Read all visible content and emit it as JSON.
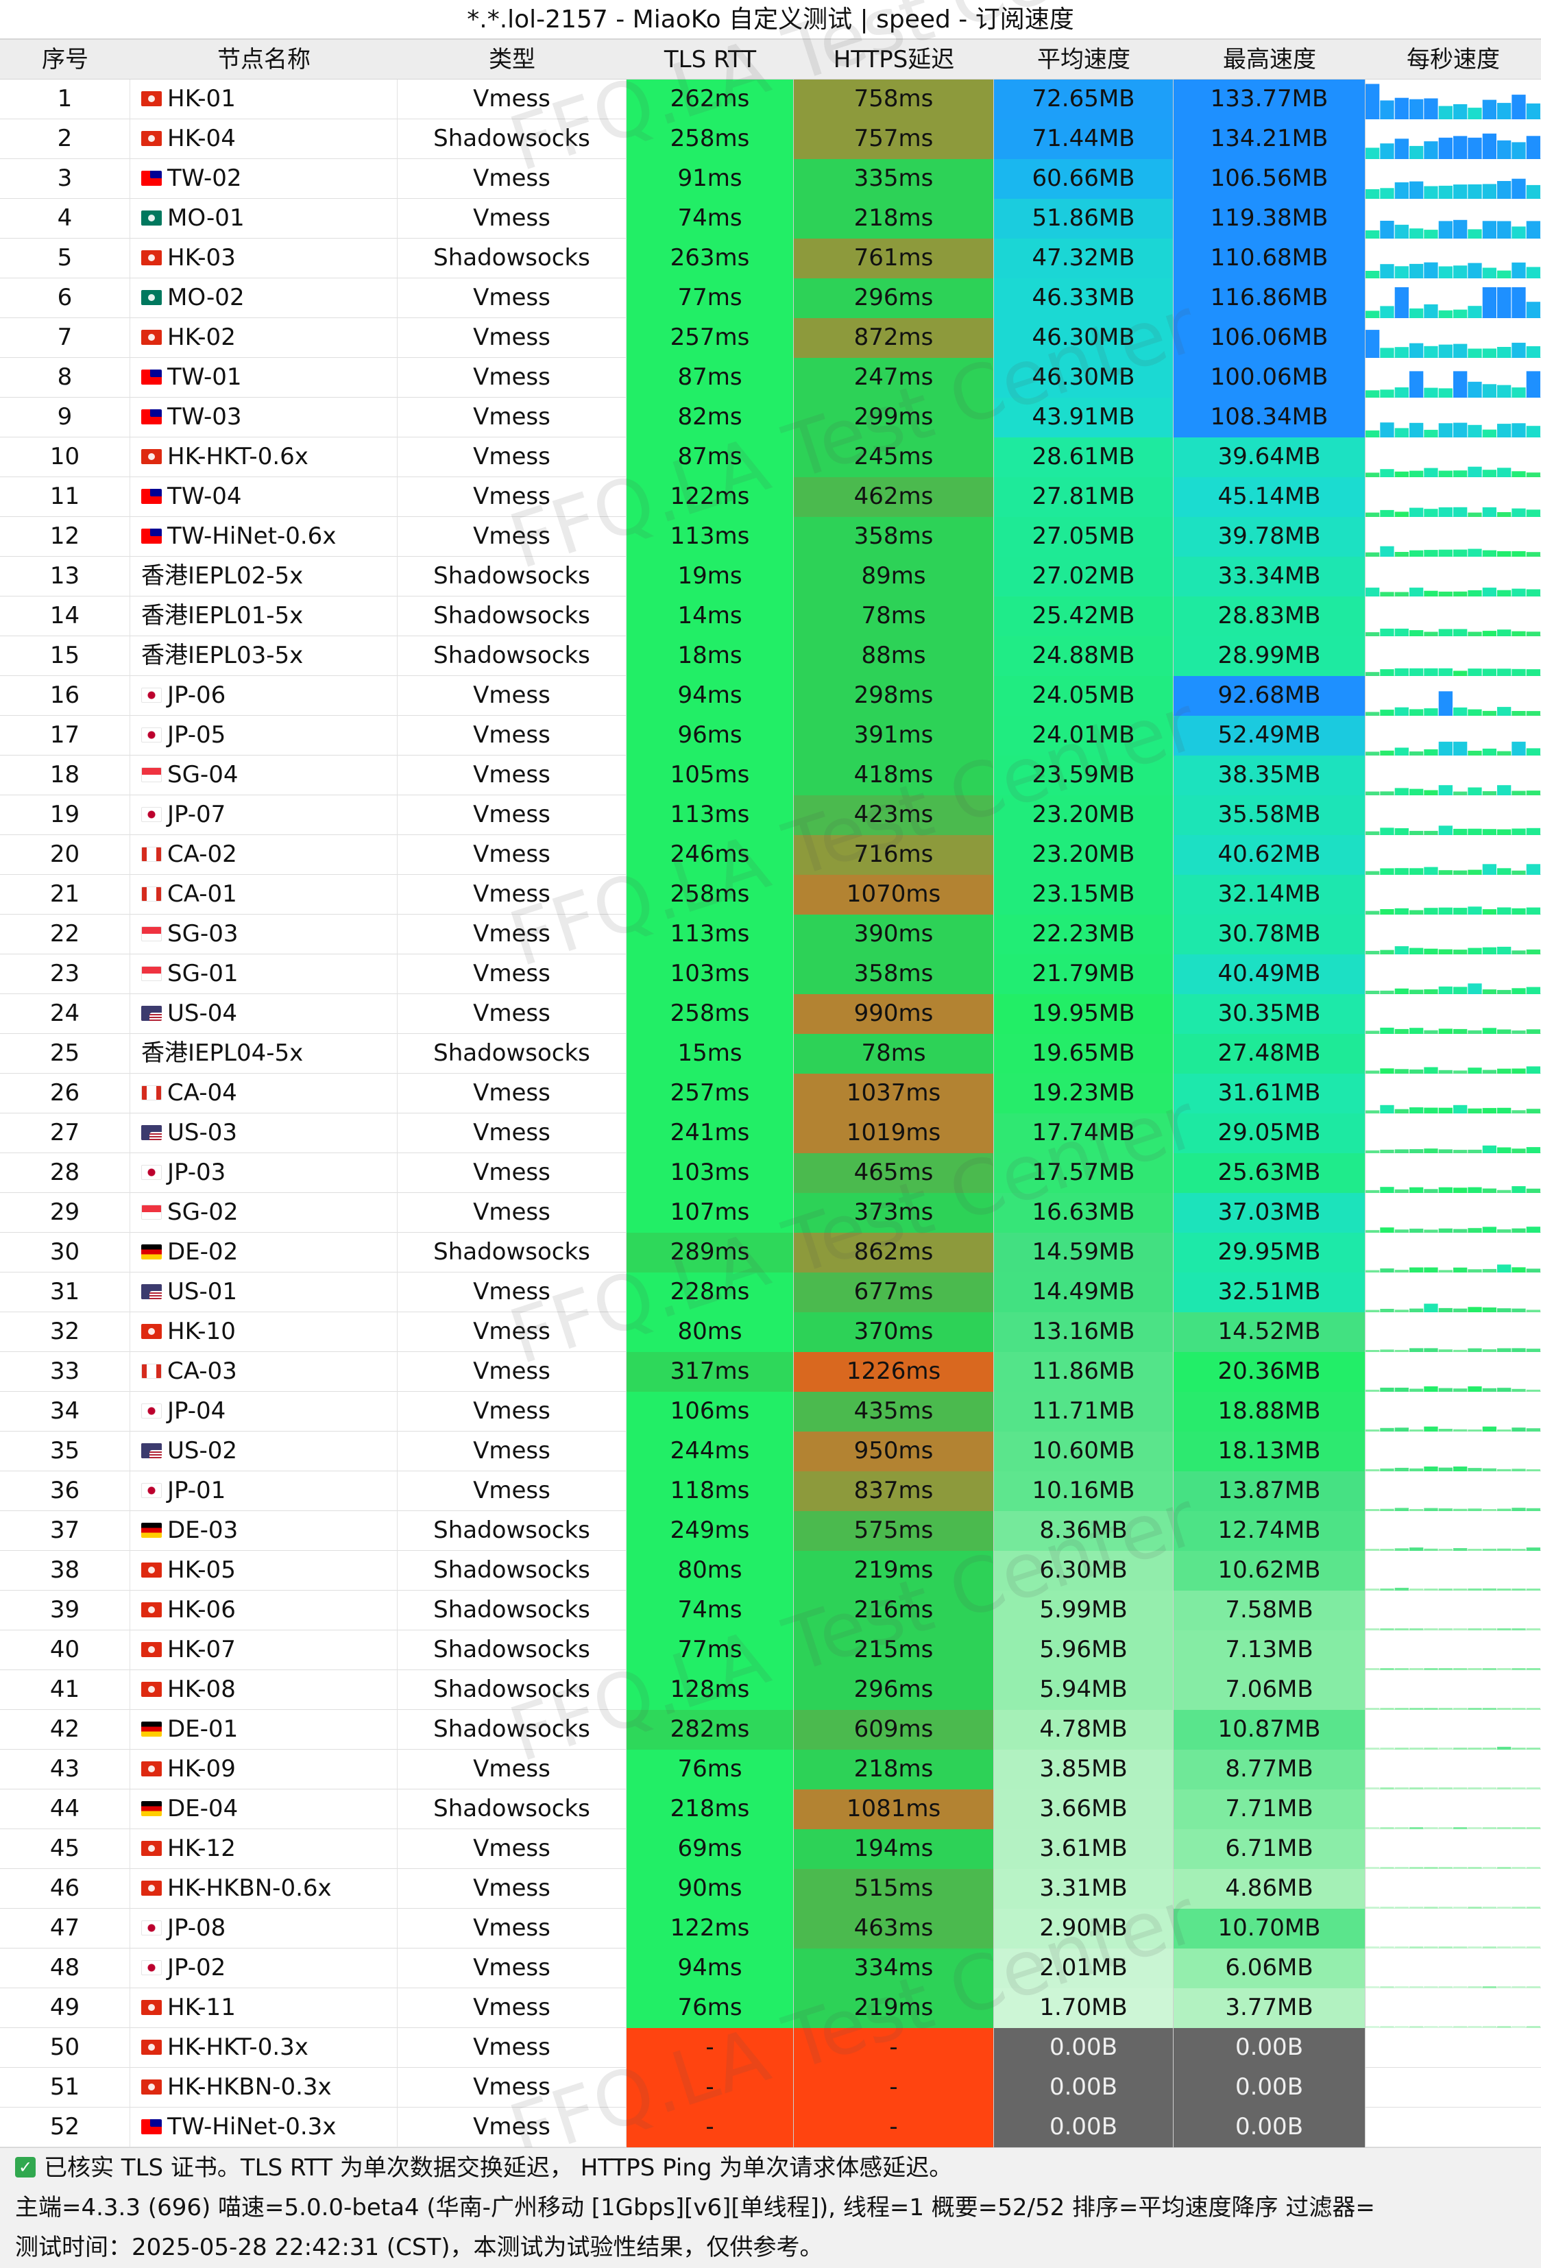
{
  "title": "*.*.lol-2157 - MiaoKo 自定义测试 | speed - 订阅速度",
  "header": {
    "idx": "序号",
    "name": "节点名称",
    "type": "类型",
    "tls": "TLS RTT",
    "https": "HTTPS延迟",
    "avg": "平均速度",
    "max": "最高速度",
    "spark": "每秒速度"
  },
  "watermark": "FFQ.LA Test Center",
  "colors": {
    "tls_normal": "#22ee66",
    "tls_slow": "#2ed85a",
    "tls_fail": "#ff4410",
    "https_fast": "#2dd257",
    "https_mid": "#4bba4e",
    "https_slow": "#8d9a3c",
    "https_very_slow": "#b38332",
    "https_worst": "#d9681f",
    "speed_fail": "#666666",
    "spark_blue": "#1e90ff"
  },
  "rows": [
    {
      "idx": "1",
      "flag": "HK",
      "name": "HK-01",
      "type": "Vmess",
      "tls": "262ms",
      "https": "758ms",
      "avg": "72.65MB",
      "max": "133.77MB",
      "avg_v": 72.65,
      "max_v": 133.77
    },
    {
      "idx": "2",
      "flag": "HK",
      "name": "HK-04",
      "type": "Shadowsocks",
      "tls": "258ms",
      "https": "757ms",
      "avg": "71.44MB",
      "max": "134.21MB",
      "avg_v": 71.44,
      "max_v": 134.21
    },
    {
      "idx": "3",
      "flag": "TW",
      "name": "TW-02",
      "type": "Vmess",
      "tls": "91ms",
      "https": "335ms",
      "avg": "60.66MB",
      "max": "106.56MB",
      "avg_v": 60.66,
      "max_v": 106.56
    },
    {
      "idx": "4",
      "flag": "MO",
      "name": "MO-01",
      "type": "Vmess",
      "tls": "74ms",
      "https": "218ms",
      "avg": "51.86MB",
      "max": "119.38MB",
      "avg_v": 51.86,
      "max_v": 119.38
    },
    {
      "idx": "5",
      "flag": "HK",
      "name": "HK-03",
      "type": "Shadowsocks",
      "tls": "263ms",
      "https": "761ms",
      "avg": "47.32MB",
      "max": "110.68MB",
      "avg_v": 47.32,
      "max_v": 110.68
    },
    {
      "idx": "6",
      "flag": "MO",
      "name": "MO-02",
      "type": "Vmess",
      "tls": "77ms",
      "https": "296ms",
      "avg": "46.33MB",
      "max": "116.86MB",
      "avg_v": 46.33,
      "max_v": 116.86
    },
    {
      "idx": "7",
      "flag": "HK",
      "name": "HK-02",
      "type": "Vmess",
      "tls": "257ms",
      "https": "872ms",
      "avg": "46.30MB",
      "max": "106.06MB",
      "avg_v": 46.3,
      "max_v": 106.06
    },
    {
      "idx": "8",
      "flag": "TW",
      "name": "TW-01",
      "type": "Vmess",
      "tls": "87ms",
      "https": "247ms",
      "avg": "46.30MB",
      "max": "100.06MB",
      "avg_v": 46.3,
      "max_v": 100.06
    },
    {
      "idx": "9",
      "flag": "TW",
      "name": "TW-03",
      "type": "Vmess",
      "tls": "82ms",
      "https": "299ms",
      "avg": "43.91MB",
      "max": "108.34MB",
      "avg_v": 43.91,
      "max_v": 108.34
    },
    {
      "idx": "10",
      "flag": "HK",
      "name": "HK-HKT-0.6x",
      "type": "Vmess",
      "tls": "87ms",
      "https": "245ms",
      "avg": "28.61MB",
      "max": "39.64MB",
      "avg_v": 28.61,
      "max_v": 39.64
    },
    {
      "idx": "11",
      "flag": "TW",
      "name": "TW-04",
      "type": "Vmess",
      "tls": "122ms",
      "https": "462ms",
      "avg": "27.81MB",
      "max": "45.14MB",
      "avg_v": 27.81,
      "max_v": 45.14
    },
    {
      "idx": "12",
      "flag": "TW",
      "name": "TW-HiNet-0.6x",
      "type": "Vmess",
      "tls": "113ms",
      "https": "358ms",
      "avg": "27.05MB",
      "max": "39.78MB",
      "avg_v": 27.05,
      "max_v": 39.78
    },
    {
      "idx": "13",
      "flag": "",
      "name": "香港IEPL02-5x",
      "type": "Shadowsocks",
      "tls": "19ms",
      "https": "89ms",
      "avg": "27.02MB",
      "max": "33.34MB",
      "avg_v": 27.02,
      "max_v": 33.34
    },
    {
      "idx": "14",
      "flag": "",
      "name": "香港IEPL01-5x",
      "type": "Shadowsocks",
      "tls": "14ms",
      "https": "78ms",
      "avg": "25.42MB",
      "max": "28.83MB",
      "avg_v": 25.42,
      "max_v": 28.83
    },
    {
      "idx": "15",
      "flag": "",
      "name": "香港IEPL03-5x",
      "type": "Shadowsocks",
      "tls": "18ms",
      "https": "88ms",
      "avg": "24.88MB",
      "max": "28.99MB",
      "avg_v": 24.88,
      "max_v": 28.99
    },
    {
      "idx": "16",
      "flag": "JP",
      "name": "JP-06",
      "type": "Vmess",
      "tls": "94ms",
      "https": "298ms",
      "avg": "24.05MB",
      "max": "92.68MB",
      "avg_v": 24.05,
      "max_v": 92.68
    },
    {
      "idx": "17",
      "flag": "JP",
      "name": "JP-05",
      "type": "Vmess",
      "tls": "96ms",
      "https": "391ms",
      "avg": "24.01MB",
      "max": "52.49MB",
      "avg_v": 24.01,
      "max_v": 52.49
    },
    {
      "idx": "18",
      "flag": "SG",
      "name": "SG-04",
      "type": "Vmess",
      "tls": "105ms",
      "https": "418ms",
      "avg": "23.59MB",
      "max": "38.35MB",
      "avg_v": 23.59,
      "max_v": 38.35
    },
    {
      "idx": "19",
      "flag": "JP",
      "name": "JP-07",
      "type": "Vmess",
      "tls": "113ms",
      "https": "423ms",
      "avg": "23.20MB",
      "max": "35.58MB",
      "avg_v": 23.2,
      "max_v": 35.58
    },
    {
      "idx": "20",
      "flag": "CA",
      "name": "CA-02",
      "type": "Vmess",
      "tls": "246ms",
      "https": "716ms",
      "avg": "23.20MB",
      "max": "40.62MB",
      "avg_v": 23.2,
      "max_v": 40.62
    },
    {
      "idx": "21",
      "flag": "CA",
      "name": "CA-01",
      "type": "Vmess",
      "tls": "258ms",
      "https": "1070ms",
      "avg": "23.15MB",
      "max": "32.14MB",
      "avg_v": 23.15,
      "max_v": 32.14
    },
    {
      "idx": "22",
      "flag": "SG",
      "name": "SG-03",
      "type": "Vmess",
      "tls": "113ms",
      "https": "390ms",
      "avg": "22.23MB",
      "max": "30.78MB",
      "avg_v": 22.23,
      "max_v": 30.78
    },
    {
      "idx": "23",
      "flag": "SG",
      "name": "SG-01",
      "type": "Vmess",
      "tls": "103ms",
      "https": "358ms",
      "avg": "21.79MB",
      "max": "40.49MB",
      "avg_v": 21.79,
      "max_v": 40.49
    },
    {
      "idx": "24",
      "flag": "US",
      "name": "US-04",
      "type": "Vmess",
      "tls": "258ms",
      "https": "990ms",
      "avg": "19.95MB",
      "max": "30.35MB",
      "avg_v": 19.95,
      "max_v": 30.35
    },
    {
      "idx": "25",
      "flag": "",
      "name": "香港IEPL04-5x",
      "type": "Shadowsocks",
      "tls": "15ms",
      "https": "78ms",
      "avg": "19.65MB",
      "max": "27.48MB",
      "avg_v": 19.65,
      "max_v": 27.48
    },
    {
      "idx": "26",
      "flag": "CA",
      "name": "CA-04",
      "type": "Vmess",
      "tls": "257ms",
      "https": "1037ms",
      "avg": "19.23MB",
      "max": "31.61MB",
      "avg_v": 19.23,
      "max_v": 31.61
    },
    {
      "idx": "27",
      "flag": "US",
      "name": "US-03",
      "type": "Vmess",
      "tls": "241ms",
      "https": "1019ms",
      "avg": "17.74MB",
      "max": "29.05MB",
      "avg_v": 17.74,
      "max_v": 29.05
    },
    {
      "idx": "28",
      "flag": "JP",
      "name": "JP-03",
      "type": "Vmess",
      "tls": "103ms",
      "https": "465ms",
      "avg": "17.57MB",
      "max": "25.63MB",
      "avg_v": 17.57,
      "max_v": 25.63
    },
    {
      "idx": "29",
      "flag": "SG",
      "name": "SG-02",
      "type": "Vmess",
      "tls": "107ms",
      "https": "373ms",
      "avg": "16.63MB",
      "max": "37.03MB",
      "avg_v": 16.63,
      "max_v": 37.03
    },
    {
      "idx": "30",
      "flag": "DE",
      "name": "DE-02",
      "type": "Shadowsocks",
      "tls": "289ms",
      "https": "862ms",
      "avg": "14.59MB",
      "max": "29.95MB",
      "avg_v": 14.59,
      "max_v": 29.95
    },
    {
      "idx": "31",
      "flag": "US",
      "name": "US-01",
      "type": "Vmess",
      "tls": "228ms",
      "https": "677ms",
      "avg": "14.49MB",
      "max": "32.51MB",
      "avg_v": 14.49,
      "max_v": 32.51
    },
    {
      "idx": "32",
      "flag": "HK",
      "name": "HK-10",
      "type": "Vmess",
      "tls": "80ms",
      "https": "370ms",
      "avg": "13.16MB",
      "max": "14.52MB",
      "avg_v": 13.16,
      "max_v": 14.52
    },
    {
      "idx": "33",
      "flag": "CA",
      "name": "CA-03",
      "type": "Vmess",
      "tls": "317ms",
      "https": "1226ms",
      "avg": "11.86MB",
      "max": "20.36MB",
      "avg_v": 11.86,
      "max_v": 20.36
    },
    {
      "idx": "34",
      "flag": "JP",
      "name": "JP-04",
      "type": "Vmess",
      "tls": "106ms",
      "https": "435ms",
      "avg": "11.71MB",
      "max": "18.88MB",
      "avg_v": 11.71,
      "max_v": 18.88
    },
    {
      "idx": "35",
      "flag": "US",
      "name": "US-02",
      "type": "Vmess",
      "tls": "244ms",
      "https": "950ms",
      "avg": "10.60MB",
      "max": "18.13MB",
      "avg_v": 10.6,
      "max_v": 18.13
    },
    {
      "idx": "36",
      "flag": "JP",
      "name": "JP-01",
      "type": "Vmess",
      "tls": "118ms",
      "https": "837ms",
      "avg": "10.16MB",
      "max": "13.87MB",
      "avg_v": 10.16,
      "max_v": 13.87
    },
    {
      "idx": "37",
      "flag": "DE",
      "name": "DE-03",
      "type": "Shadowsocks",
      "tls": "249ms",
      "https": "575ms",
      "avg": "8.36MB",
      "max": "12.74MB",
      "avg_v": 8.36,
      "max_v": 12.74
    },
    {
      "idx": "38",
      "flag": "HK",
      "name": "HK-05",
      "type": "Shadowsocks",
      "tls": "80ms",
      "https": "219ms",
      "avg": "6.30MB",
      "max": "10.62MB",
      "avg_v": 6.3,
      "max_v": 10.62
    },
    {
      "idx": "39",
      "flag": "HK",
      "name": "HK-06",
      "type": "Shadowsocks",
      "tls": "74ms",
      "https": "216ms",
      "avg": "5.99MB",
      "max": "7.58MB",
      "avg_v": 5.99,
      "max_v": 7.58
    },
    {
      "idx": "40",
      "flag": "HK",
      "name": "HK-07",
      "type": "Shadowsocks",
      "tls": "77ms",
      "https": "215ms",
      "avg": "5.96MB",
      "max": "7.13MB",
      "avg_v": 5.96,
      "max_v": 7.13
    },
    {
      "idx": "41",
      "flag": "HK",
      "name": "HK-08",
      "type": "Shadowsocks",
      "tls": "128ms",
      "https": "296ms",
      "avg": "5.94MB",
      "max": "7.06MB",
      "avg_v": 5.94,
      "max_v": 7.06
    },
    {
      "idx": "42",
      "flag": "DE",
      "name": "DE-01",
      "type": "Shadowsocks",
      "tls": "282ms",
      "https": "609ms",
      "avg": "4.78MB",
      "max": "10.87MB",
      "avg_v": 4.78,
      "max_v": 10.87
    },
    {
      "idx": "43",
      "flag": "HK",
      "name": "HK-09",
      "type": "Vmess",
      "tls": "76ms",
      "https": "218ms",
      "avg": "3.85MB",
      "max": "8.77MB",
      "avg_v": 3.85,
      "max_v": 8.77
    },
    {
      "idx": "44",
      "flag": "DE",
      "name": "DE-04",
      "type": "Shadowsocks",
      "tls": "218ms",
      "https": "1081ms",
      "avg": "3.66MB",
      "max": "7.71MB",
      "avg_v": 3.66,
      "max_v": 7.71
    },
    {
      "idx": "45",
      "flag": "HK",
      "name": "HK-12",
      "type": "Vmess",
      "tls": "69ms",
      "https": "194ms",
      "avg": "3.61MB",
      "max": "6.71MB",
      "avg_v": 3.61,
      "max_v": 6.71
    },
    {
      "idx": "46",
      "flag": "HK",
      "name": "HK-HKBN-0.6x",
      "type": "Vmess",
      "tls": "90ms",
      "https": "515ms",
      "avg": "3.31MB",
      "max": "4.86MB",
      "avg_v": 3.31,
      "max_v": 4.86
    },
    {
      "idx": "47",
      "flag": "JP",
      "name": "JP-08",
      "type": "Vmess",
      "tls": "122ms",
      "https": "463ms",
      "avg": "2.90MB",
      "max": "10.70MB",
      "avg_v": 2.9,
      "max_v": 10.7
    },
    {
      "idx": "48",
      "flag": "JP",
      "name": "JP-02",
      "type": "Vmess",
      "tls": "94ms",
      "https": "334ms",
      "avg": "2.01MB",
      "max": "6.06MB",
      "avg_v": 2.01,
      "max_v": 6.06
    },
    {
      "idx": "49",
      "flag": "HK",
      "name": "HK-11",
      "type": "Vmess",
      "tls": "76ms",
      "https": "219ms",
      "avg": "1.70MB",
      "max": "3.77MB",
      "avg_v": 1.7,
      "max_v": 3.77
    },
    {
      "idx": "50",
      "flag": "HK",
      "name": "HK-HKT-0.3x",
      "type": "Vmess",
      "tls": "-",
      "https": "-",
      "avg": "0.00B",
      "max": "0.00B",
      "avg_v": 0,
      "max_v": 0
    },
    {
      "idx": "51",
      "flag": "HK",
      "name": "HK-HKBN-0.3x",
      "type": "Vmess",
      "tls": "-",
      "https": "-",
      "avg": "0.00B",
      "max": "0.00B",
      "avg_v": 0,
      "max_v": 0
    },
    {
      "idx": "52",
      "flag": "TW",
      "name": "TW-HiNet-0.3x",
      "type": "Vmess",
      "tls": "-",
      "https": "-",
      "avg": "0.00B",
      "max": "0.00B",
      "avg_v": 0,
      "max_v": 0
    }
  ],
  "footer": {
    "line1": "已核实 TLS 证书。TLS RTT 为单次数据交换延迟， HTTPS Ping 为单次请求体感延迟。",
    "line2": "主端=4.3.3 (696) 喵速=5.0.0-beta4 (华南-广州移动 [1Gbps][v6][单线程]), 线程=1 概要=52/52 排序=平均速度降序 过滤器=",
    "line3": "测试时间：2025-05-28 22:42:31 (CST)，本测试为试验性结果，仅供参考。"
  }
}
